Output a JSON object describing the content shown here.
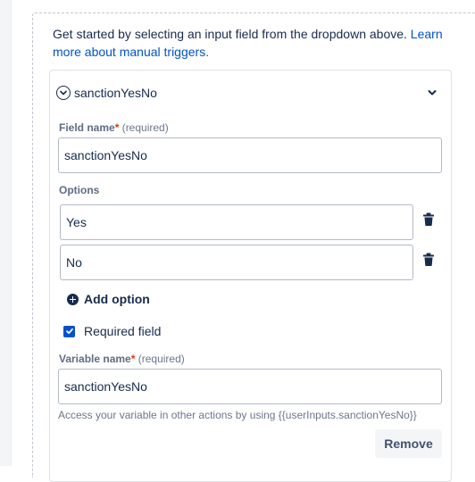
{
  "intro": {
    "text": "Get started by selecting an input field from the dropdown above. ",
    "link_text": "Learn more about manual triggers."
  },
  "card": {
    "title": "sanctionYesNo",
    "expanded": true
  },
  "field_name": {
    "label": "Field name",
    "required_star": "*",
    "required_note": " (required)",
    "value": "sanctionYesNo"
  },
  "options": {
    "label": "Options",
    "items": [
      {
        "value": "Yes"
      },
      {
        "value": "No"
      }
    ],
    "add_label": "Add option"
  },
  "required_field": {
    "label": "Required field",
    "checked": true
  },
  "variable_name": {
    "label": "Variable name",
    "required_star": "*",
    "required_note": " (required)",
    "value": "sanctionYesNo",
    "helper": "Access your variable in other actions by using {{userInputs.sanctionYesNo}}"
  },
  "actions": {
    "remove_label": "Remove"
  },
  "colors": {
    "link": "#0052cc",
    "checkbox": "#0052cc",
    "text": "#172b4d",
    "required_star": "#de350b"
  }
}
